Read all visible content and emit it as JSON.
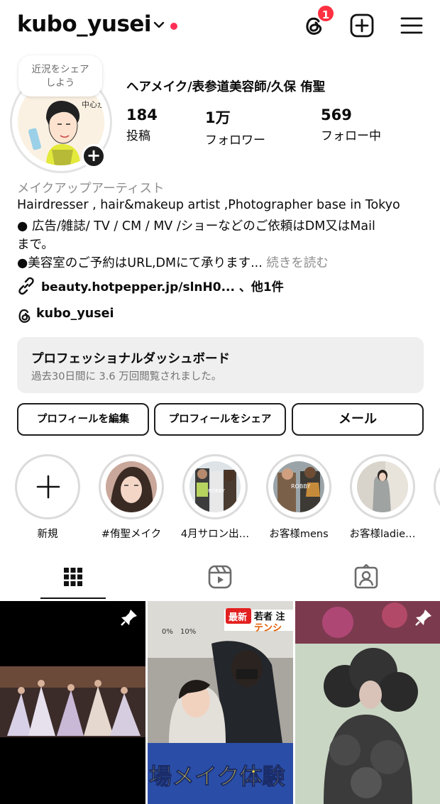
{
  "header": {
    "username": "kubo_yusei",
    "notification_count": "1",
    "brand_red": "#ff2d55"
  },
  "profile": {
    "note_bubble": "近況をシェアしよう",
    "note_line1": "近況をシェア",
    "note_line2": "しよう",
    "full_name": "ヘアメイク/表参道美容師/久保 侑聖",
    "stats": [
      {
        "value": "184",
        "label": "投稿"
      },
      {
        "value": "1万",
        "label": "フォロワー"
      },
      {
        "value": "569",
        "label": "フォロー中"
      }
    ],
    "avatar_text": "中心から外"
  },
  "bio": {
    "category": "メイクアップアーティスト",
    "line1": "Hairdresser , hair&makeup artist ,Photographer base in Tokyo",
    "line2": "● 広告/雑誌/ TV / CM / MV /ショーなどのご依頼はDM又はMail",
    "line3": "まで。",
    "line4": "●美容室のご予約はURL,DMにて承ります...",
    "more": "続きを読む",
    "link": "beauty.hotpepper.jp/slnH0... 、他1件",
    "threads_handle": "kubo_yusei"
  },
  "dashboard": {
    "title": "プロフェッショナルダッシュボード",
    "subtitle": "過去30日間に 3.6 万回閲覧されました。"
  },
  "buttons": {
    "edit": "プロフィールを編集",
    "share": "プロフィールをシェア",
    "mail": "メール"
  },
  "highlights": [
    {
      "label": "新規"
    },
    {
      "label": "#侑聖メイク"
    },
    {
      "label": "4月サロン出…"
    },
    {
      "label": "お客様mens",
      "overlay": "ROBBY"
    },
    {
      "label": "お客様ladie…"
    }
  ],
  "highlight_overlays": {
    "robby": "ROBBY"
  },
  "tabs": [
    "grid-icon",
    "reels-icon",
    "tagged-icon"
  ],
  "posts": {
    "p2_badge": "最新",
    "p2_caption_top": "若者 注",
    "p2_caption_top2": "テンシ",
    "p2_banner": "場メイク体験",
    "p2_signs": [
      "0%",
      "10%"
    ]
  }
}
